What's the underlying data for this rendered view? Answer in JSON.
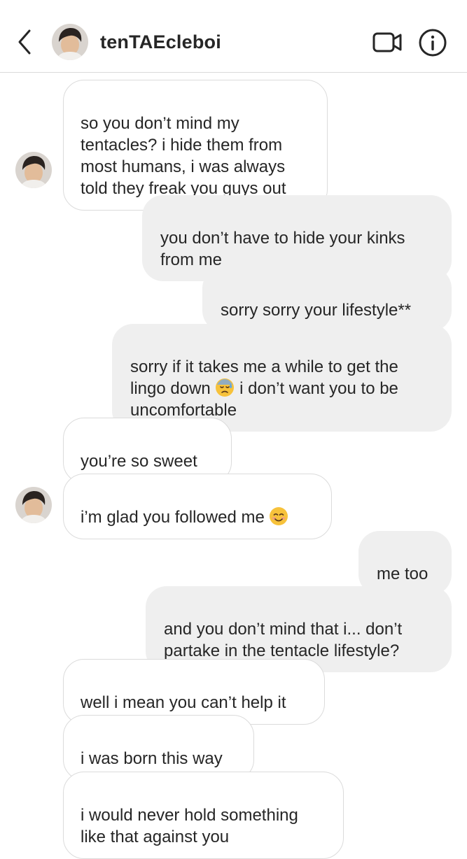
{
  "header": {
    "username": "tenTAEcleboi",
    "back_icon": "chevron-left-icon",
    "video_icon": "video-camera-icon",
    "info_icon": "info-icon"
  },
  "messages": [
    {
      "side": "received",
      "text": "so you don’t mind my\ntentacles? i hide them from\nmost humans, i was always\ntold they freak you guys out"
    },
    {
      "side": "sent",
      "text": "you don’t have to hide your kinks\nfrom me"
    },
    {
      "side": "sent",
      "text": "sorry sorry your lifestyle**"
    },
    {
      "side": "sent",
      "text_a": "sorry if it takes me a while to get the\nlingo down ",
      "emoji": "sweat-emoji",
      "text_b": " i don’t want you to be\nuncomfortable"
    },
    {
      "side": "received",
      "text": "you’re so sweet"
    },
    {
      "side": "received",
      "text": "i’m glad you followed me ",
      "emoji": "smiling-face-emoji"
    },
    {
      "side": "sent",
      "text": "me too"
    },
    {
      "side": "sent",
      "text": "and you don’t mind that i... don’t\npartake in the tentacle lifestyle?"
    },
    {
      "side": "received",
      "text": "well i mean you can’t help it"
    },
    {
      "side": "received",
      "text": "i was born this way"
    },
    {
      "side": "received",
      "text": "i would never hold something\nlike that against you"
    }
  ],
  "colors": {
    "sent_bubble": "#efefef",
    "received_border": "#dbdbdb",
    "text": "#262626"
  }
}
